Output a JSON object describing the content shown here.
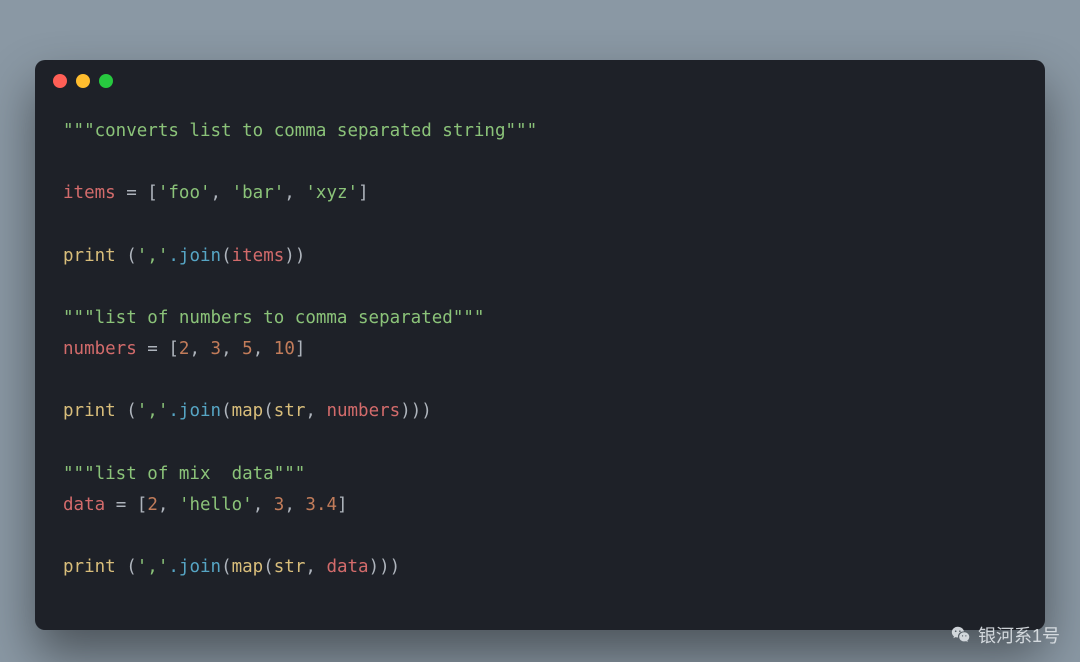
{
  "code": {
    "l1_docstring": "\"\"\"converts list to comma separated string\"\"\"",
    "l3_items": "items",
    "l3_assign": " = [",
    "l3_v1": "'foo'",
    "l3_v2": "'bar'",
    "l3_v3": "'xyz'",
    "l5_print": "print",
    "l5_sep": "','",
    "l5_join": ".join",
    "l5_arg": "items",
    "l7_docstring": "\"\"\"list of numbers to comma separated\"\"\"",
    "l8_numbers": "numbers",
    "l8_assign": " = [",
    "l8_v1": "2",
    "l8_v2": "3",
    "l8_v3": "5",
    "l8_v4": "10",
    "l10_print": "print",
    "l10_sep": "','",
    "l10_join": ".join",
    "l10_map": "map",
    "l10_str": "str",
    "l10_arg": "numbers",
    "l12_docstring": "\"\"\"list of mix  data\"\"\"",
    "l13_data": "data",
    "l13_assign": " = [",
    "l13_v1": "2",
    "l13_v2": "'hello'",
    "l13_v3": "3",
    "l13_v4": "3.4",
    "l15_print": "print",
    "l15_sep": "','",
    "l15_join": ".join",
    "l15_map": "map",
    "l15_str": "str",
    "l15_arg": "data",
    "comma": ", ",
    "close_bracket": "]",
    "open_paren": " (",
    "open_paren2": "(",
    "close_paren": ")",
    "close_paren2": "))",
    "close_paren3": ")))"
  },
  "watermark": {
    "text": "银河系1号"
  }
}
